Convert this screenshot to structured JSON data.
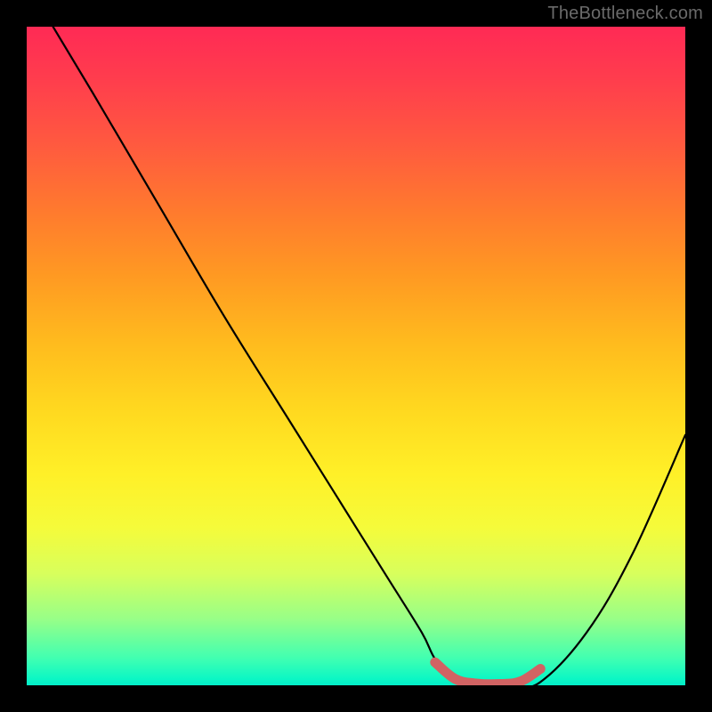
{
  "watermark": "TheBottleneck.com",
  "colors": {
    "background": "#000000",
    "accent_line": "#d16363",
    "curve": "#000000",
    "gradient_top": "#ff2a55",
    "gradient_bottom": "#03edc8"
  },
  "chart_data": {
    "type": "line",
    "title": "",
    "xlabel": "",
    "ylabel": "",
    "xlim": [
      0,
      100
    ],
    "ylim": [
      0,
      100
    ],
    "series": [
      {
        "name": "bottleneck-curve",
        "x": [
          4,
          10,
          20,
          30,
          40,
          50,
          55,
          60,
          62,
          65,
          68,
          70,
          74,
          78,
          85,
          92,
          100
        ],
        "y": [
          100,
          90,
          73,
          56,
          40,
          24,
          16,
          8,
          4,
          0.5,
          0,
          0,
          0,
          0.5,
          8,
          20,
          38
        ]
      },
      {
        "name": "optimal-range-highlight",
        "x": [
          62,
          65,
          68,
          72,
          75,
          78
        ],
        "y": [
          3.5,
          1,
          0.3,
          0.2,
          0.6,
          2.5
        ]
      }
    ],
    "annotations": []
  }
}
